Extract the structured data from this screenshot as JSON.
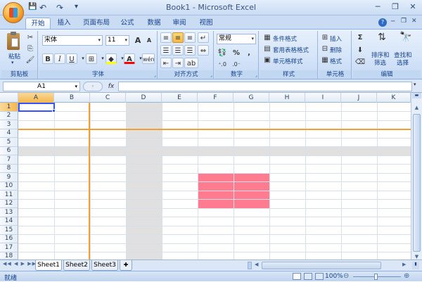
{
  "window": {
    "title": "Book1 - Microsoft Excel"
  },
  "quick_access": {
    "save": "💾",
    "undo": "↶",
    "redo": "↷",
    "customize": "▾"
  },
  "window_controls": {
    "help": "?",
    "minimize": "─",
    "restore": "❐",
    "close": "✕"
  },
  "tabs": [
    {
      "label": "开始",
      "active": true
    },
    {
      "label": "插入"
    },
    {
      "label": "页面布局"
    },
    {
      "label": "公式"
    },
    {
      "label": "数据"
    },
    {
      "label": "审阅"
    },
    {
      "label": "视图"
    }
  ],
  "ribbon": {
    "clipboard": {
      "label": "剪贴板",
      "paste": "粘贴"
    },
    "font": {
      "label": "字体",
      "font_name": "宋体",
      "font_size": "11",
      "bold": "B",
      "italic": "I",
      "underline": "U",
      "grow": "A",
      "shrink": "A",
      "font_color_letter": "A",
      "phonetic": "wén"
    },
    "alignment": {
      "label": "对齐方式"
    },
    "number": {
      "label": "数字",
      "format": "常规",
      "percent": "%",
      "comma": ","
    },
    "styles": {
      "label": "样式",
      "conditional": "条件格式",
      "table": "套用表格格式",
      "cell_style": "单元格样式"
    },
    "cells": {
      "label": "单元格",
      "insert": "插入",
      "delete": "删除",
      "format": "格式"
    },
    "editing": {
      "label": "编辑",
      "sigma": "Σ",
      "sort": "排序和",
      "filter": "筛选",
      "find": "查找和",
      "select": "选择"
    }
  },
  "formula_bar": {
    "name_box": "A1",
    "fx": "fx",
    "value": ""
  },
  "columns": [
    "A",
    "B",
    "C",
    "D",
    "E",
    "F",
    "G",
    "H",
    "I",
    "J",
    "K"
  ],
  "rows": [
    "1",
    "2",
    "3",
    "4",
    "5",
    "6",
    "7",
    "8",
    "9",
    "10",
    "11",
    "12",
    "13",
    "14",
    "15",
    "16",
    "17",
    "18"
  ],
  "sheets": [
    {
      "label": "Sheet1",
      "active": true
    },
    {
      "label": "Sheet2"
    },
    {
      "label": "Sheet3"
    }
  ],
  "status": {
    "ready": "就绪",
    "zoom": "100%",
    "zoom_out": "⊖",
    "zoom_in": "⊕"
  },
  "colors": {
    "selection": "#3355ff",
    "highlight_line": "#f0a030",
    "gray_fill": "#e0e0e0",
    "pink_fill": "#ff7b8f"
  }
}
